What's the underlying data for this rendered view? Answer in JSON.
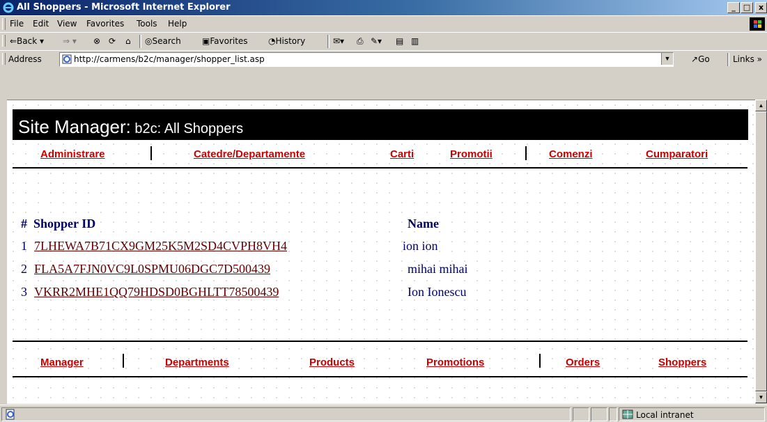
{
  "window": {
    "title": "All Shoppers - Microsoft Internet Explorer",
    "min": "_",
    "max": "□",
    "close": "x"
  },
  "menu": [
    "File",
    "Edit",
    "View",
    "Favorites",
    "Tools",
    "Help"
  ],
  "toolbar": {
    "back": "⇐Back",
    "search": "Search",
    "favorites": "Favorites",
    "history": "History"
  },
  "address": {
    "label": "Address",
    "url": "http://carmens/b2c/manager/shopper_list.asp",
    "go": "Go",
    "links": "Links"
  },
  "page": {
    "header_main": "Site Manager:",
    "header_sub": " b2c: All Shoppers",
    "top_nav": [
      "Administrare",
      "Catedre/Departamente",
      "Carti",
      "Promotii",
      "Comenzi",
      "Cumparatori"
    ],
    "columns": {
      "num": "#",
      "id": "Shopper ID",
      "name": "Name"
    },
    "rows": [
      {
        "num": "1",
        "id": "7LHEWA7B71CX9GM25K5M2SD4CVPH8VH4",
        "name": "ion ion"
      },
      {
        "num": "2",
        "id": "FLA5A7FJN0VC9L0SPMU06DGC7D500439",
        "name": "mihai mihai"
      },
      {
        "num": "3",
        "id": "VKRR2MHE1QQ79HDSD0BGHLTT78500439",
        "name": "Ion Ionescu"
      }
    ],
    "bottom_nav": [
      "Manager",
      "Departments",
      "Products",
      "Promotions",
      "Orders",
      "Shoppers"
    ]
  },
  "status": {
    "zone": "Local intranet"
  },
  "colors": {
    "title_bar": "#0a246a",
    "nav_link": "#cc0000",
    "id_link": "#660000",
    "text": "#000066"
  },
  "icons": [
    "ie-logo-icon",
    "windows-logo-icon",
    "search-icon",
    "favorites-icon",
    "history-icon",
    "globe-icon"
  ]
}
